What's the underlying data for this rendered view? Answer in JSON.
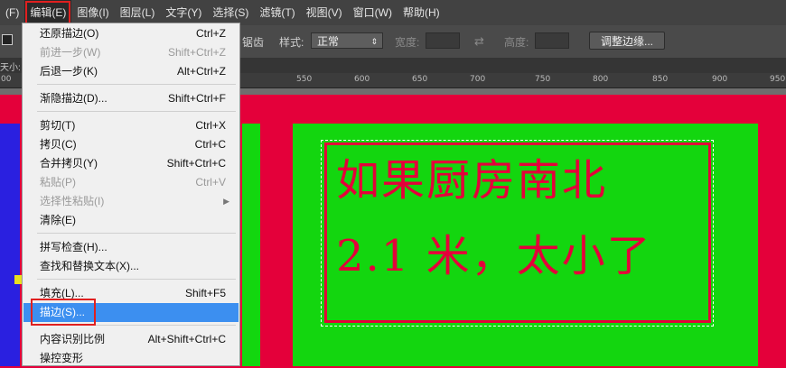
{
  "menubar": {
    "items": [
      "(F)",
      "编辑(E)",
      "图像(I)",
      "图层(L)",
      "文字(Y)",
      "选择(S)",
      "滤镜(T)",
      "视图(V)",
      "窗口(W)",
      "帮助(H)"
    ]
  },
  "options": {
    "clip_label": "锯齿",
    "style_label": "样式:",
    "style_value": "正常",
    "width_label": "宽度:",
    "height_label": "高度:",
    "refine_button": "调整边缘..."
  },
  "tab": {
    "label": "天小:"
  },
  "ruler": {
    "ticks": [
      "00",
      "550",
      "600",
      "650",
      "700",
      "750",
      "800",
      "850",
      "900",
      "950"
    ]
  },
  "menu": {
    "items": [
      {
        "label": "还原描边(O)",
        "shortcut": "Ctrl+Z"
      },
      {
        "label": "前进一步(W)",
        "shortcut": "Shift+Ctrl+Z"
      },
      {
        "label": "后退一步(K)",
        "shortcut": "Alt+Ctrl+Z"
      },
      {
        "label": "渐隐描边(D)...",
        "shortcut": "Shift+Ctrl+F"
      },
      {
        "label": "剪切(T)",
        "shortcut": "Ctrl+X"
      },
      {
        "label": "拷贝(C)",
        "shortcut": "Ctrl+C"
      },
      {
        "label": "合并拷贝(Y)",
        "shortcut": "Shift+Ctrl+C"
      },
      {
        "label": "粘贴(P)",
        "shortcut": "Ctrl+V"
      },
      {
        "label": "选择性粘贴(I)",
        "shortcut": ""
      },
      {
        "label": "清除(E)",
        "shortcut": ""
      },
      {
        "label": "拼写检查(H)...",
        "shortcut": ""
      },
      {
        "label": "查找和替换文本(X)...",
        "shortcut": ""
      },
      {
        "label": "填充(L)...",
        "shortcut": "Shift+F5"
      },
      {
        "label": "描边(S)...",
        "shortcut": ""
      },
      {
        "label": "内容识别比例",
        "shortcut": "Alt+Shift+Ctrl+C"
      },
      {
        "label": "操控变形",
        "shortcut": ""
      }
    ]
  },
  "canvas": {
    "line1": "如果厨房南北",
    "line2": "2.1 米，太小了"
  },
  "colors": {
    "red": "#e4003a",
    "green": "#13d60f",
    "blue": "#2a20e0",
    "highlight": "#3c8ff0"
  }
}
